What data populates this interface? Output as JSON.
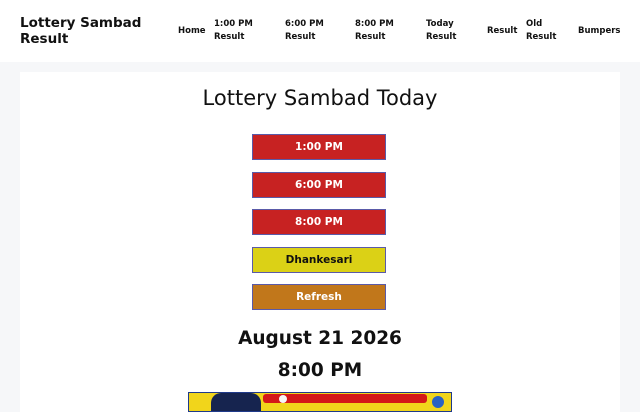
{
  "header": {
    "site_title": "Lottery Sambad Result",
    "nav": [
      {
        "label": "Home"
      },
      {
        "label": "1:00 PM Result"
      },
      {
        "label": "6:00 PM Result"
      },
      {
        "label": "8:00 PM Result"
      },
      {
        "label": "Today Result"
      },
      {
        "label": "Result"
      },
      {
        "label": "Old Result"
      },
      {
        "label": "Bumpers"
      }
    ]
  },
  "main": {
    "heading": "Lottery Sambad Today",
    "buttons": [
      {
        "label": "1:00 PM",
        "color": "#c72222"
      },
      {
        "label": "6:00 PM",
        "color": "#c72222"
      },
      {
        "label": "8:00 PM",
        "color": "#c72222"
      },
      {
        "label": "Dhankesari",
        "color": "#dbd116"
      },
      {
        "label": "Refresh",
        "color": "#c1771b"
      }
    ],
    "date": "August 21 2026",
    "time": "8:00 PM"
  }
}
